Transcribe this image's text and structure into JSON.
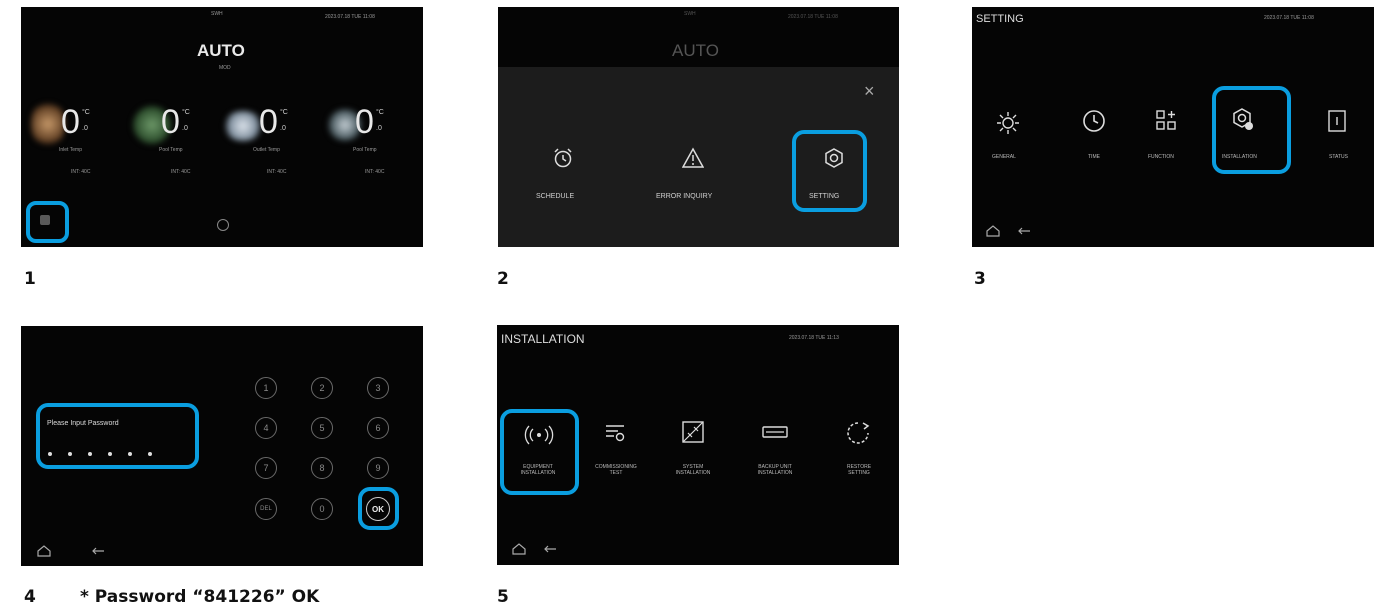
{
  "colors": {
    "highlight": "#0a9ee0",
    "screen_bg": "#050505"
  },
  "steps": {
    "s1": "1",
    "s2": "2",
    "s3": "3",
    "s4": "4",
    "s5": "5",
    "note4": "* Password “841226” OK"
  },
  "screen1": {
    "title": "AUTO",
    "header_center": "SWH",
    "datetime": "2023.07.18 TUE 11:08",
    "subtitle": "MOD",
    "temps": [
      {
        "value": "0",
        "decimal": ".0",
        "unit": "°C",
        "label": "Inlet Temp",
        "status": "INT: 40C"
      },
      {
        "value": "0",
        "decimal": ".0",
        "unit": "°C",
        "label": "Pool Temp",
        "status": "INT: 40C"
      },
      {
        "value": "0",
        "decimal": ".0",
        "unit": "°C",
        "label": "Outlet Temp",
        "status": "INT: 40C"
      },
      {
        "value": "0",
        "decimal": ".0",
        "unit": "°C",
        "label": "Pool Temp",
        "status": "INT: 40C"
      }
    ]
  },
  "screen2": {
    "title": "AUTO",
    "header_center": "SWH",
    "datetime": "2023.07.18 TUE 11:08",
    "close": "×",
    "items": [
      "SCHEDULE",
      "ERROR INQUIRY",
      "SETTING"
    ]
  },
  "screen3": {
    "title": "SETTING",
    "datetime": "2023.07.18 TUE 11:08",
    "items": [
      "GENERAL",
      "TIME",
      "FUNCTION",
      "INSTALLATION",
      "STATUS"
    ]
  },
  "screen4": {
    "prompt": "Please Input Password",
    "keys": [
      "1",
      "2",
      "3",
      "4",
      "5",
      "6",
      "7",
      "8",
      "9",
      "DEL",
      "0",
      "OK"
    ]
  },
  "screen5": {
    "title": "INSTALLATION",
    "datetime": "2023.07.18 TUE 11:13",
    "items": [
      [
        "EQUIPMENT",
        "INSTALLATION"
      ],
      [
        "COMMISSIONING",
        "TEST"
      ],
      [
        "SYSTEM",
        "INSTALLATION"
      ],
      [
        "BACKUP UNIT",
        "INSTALLATION"
      ],
      [
        "RESTORE",
        "SETTING"
      ]
    ]
  }
}
